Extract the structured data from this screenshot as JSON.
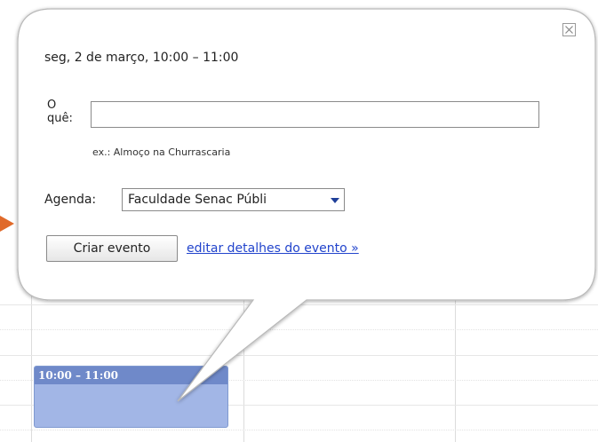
{
  "popup": {
    "datetime": "seg, 2 de março, 10:00 – 11:00",
    "what_label_line1": "O",
    "what_label_line2": "quê:",
    "what_value": "",
    "what_placeholder": "",
    "what_example": "ex.: Almoço na Churrascaria",
    "agenda_label": "Agenda:",
    "agenda_selected": "Faculdade Senac Públi",
    "create_button": "Criar evento",
    "edit_details_link": "editar detalhes do evento »",
    "close_icon": "close-x-icon"
  },
  "calendar": {
    "event_time": "10:00 – 11:00"
  },
  "colors": {
    "event_header": "#6f89c9",
    "event_body": "#a2b6e6",
    "link": "#2244cc",
    "arrow": "#e06a2a"
  }
}
